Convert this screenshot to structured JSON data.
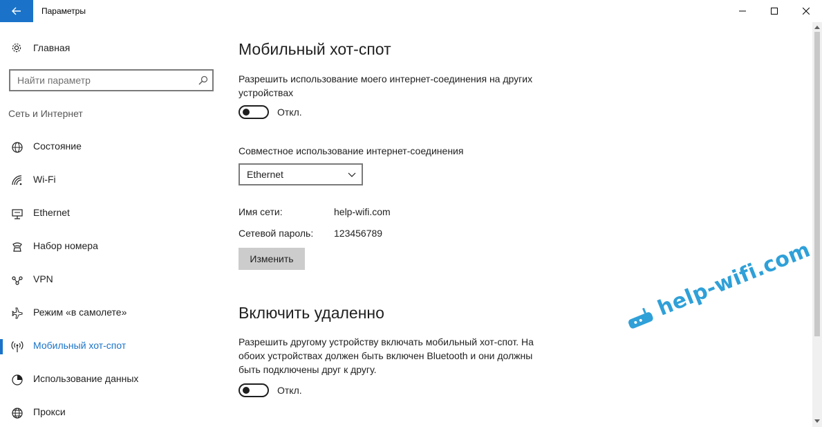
{
  "window": {
    "title": "Параметры"
  },
  "sidebar": {
    "home_label": "Главная",
    "search_placeholder": "Найти параметр",
    "section_title": "Сеть и Интернет",
    "items": [
      {
        "label": "Состояние",
        "icon": "globe-status-icon"
      },
      {
        "label": "Wi-Fi",
        "icon": "wifi-icon"
      },
      {
        "label": "Ethernet",
        "icon": "ethernet-icon"
      },
      {
        "label": "Набор номера",
        "icon": "dialup-phone-icon"
      },
      {
        "label": "VPN",
        "icon": "vpn-icon"
      },
      {
        "label": "Режим «в самолете»",
        "icon": "airplane-icon"
      },
      {
        "label": "Мобильный хот-спот",
        "icon": "hotspot-icon",
        "active": true
      },
      {
        "label": "Использование данных",
        "icon": "data-usage-icon"
      },
      {
        "label": "Прокси",
        "icon": "proxy-globe-icon"
      }
    ]
  },
  "main": {
    "title": "Мобильный хот-спот",
    "share_desc": "Разрешить использование моего интернет-соединения на других устройствах",
    "share_toggle_state": "Откл.",
    "share_from_label": "Совместное использование интернет-соединения",
    "share_from_value": "Ethernet",
    "network_name_key": "Имя сети:",
    "network_name_value": "help-wifi.com",
    "network_password_key": "Сетевой пароль:",
    "network_password_value": "123456789",
    "edit_button": "Изменить",
    "remote_title": "Включить удаленно",
    "remote_desc": "Разрешить другому устройству включать мобильный хот-спот. На обоих устройствах должен быть включен Bluetooth и они должны быть подключены друг к другу.",
    "remote_toggle_state": "Откл."
  },
  "colors": {
    "accent": "#1a73c8",
    "watermark": "#2fa0d8"
  },
  "watermark": {
    "text": "help-wifi.com"
  }
}
